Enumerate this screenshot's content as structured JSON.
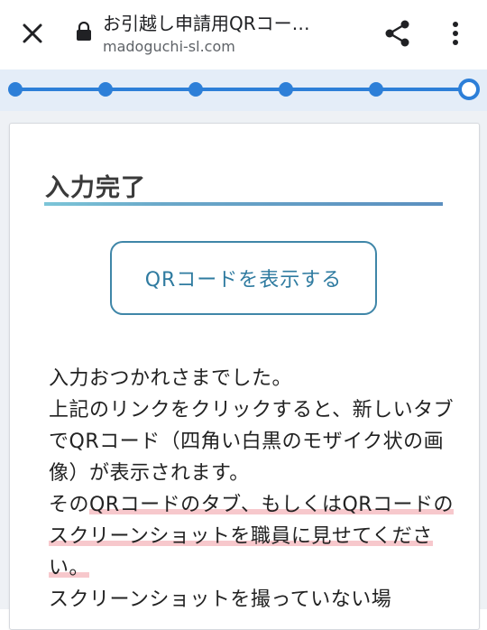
{
  "browser": {
    "tab_title": "お引越し申請用QRコー…",
    "url": "madoguchi-sl.com"
  },
  "progress": {
    "total_steps": 6,
    "current_step": 6
  },
  "main": {
    "heading": "入力完了",
    "qr_button_label": "QRコードを表示する",
    "paragraphs": {
      "line1": "入力おつかれさまでした。",
      "line2": "上記のリンクをクリックすると、新しいタブでQRコード（四角い白黒のモザイク状の画像）が表示されます。",
      "line3_pre": "その",
      "line3_hl": "QRコードのタブ、もしくはQRコードのスクリーンショットを職員に見せてください。",
      "line4": "スクリーンショットを撮っていない場"
    }
  },
  "colors": {
    "progress_line": "#2d7fd8",
    "accent_button": "#3f86a8",
    "highlight": "#f7c8cc"
  }
}
